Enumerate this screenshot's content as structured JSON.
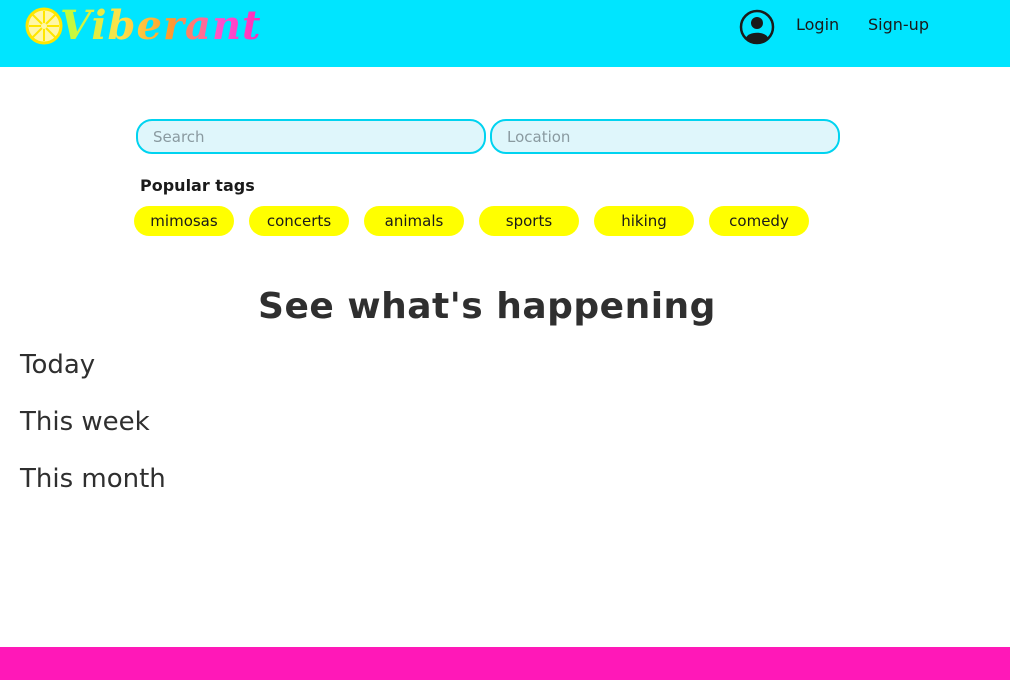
{
  "header": {
    "logo_text": "Viberant",
    "login_label": "Login",
    "signup_label": "Sign-up",
    "user_icon": "user-circle-icon",
    "background_color": "#00e5ff"
  },
  "search": {
    "search_placeholder": "Search",
    "location_placeholder": "Location"
  },
  "tags": {
    "title": "Popular tags",
    "items": [
      "mimosas",
      "concerts",
      "animals",
      "sports",
      "hiking",
      "comedy"
    ],
    "color": "#ffff00"
  },
  "main": {
    "headline": "See what's happening",
    "periods": [
      "Today",
      "This week",
      "This month"
    ]
  },
  "footer": {
    "color": "#ff18b8"
  }
}
